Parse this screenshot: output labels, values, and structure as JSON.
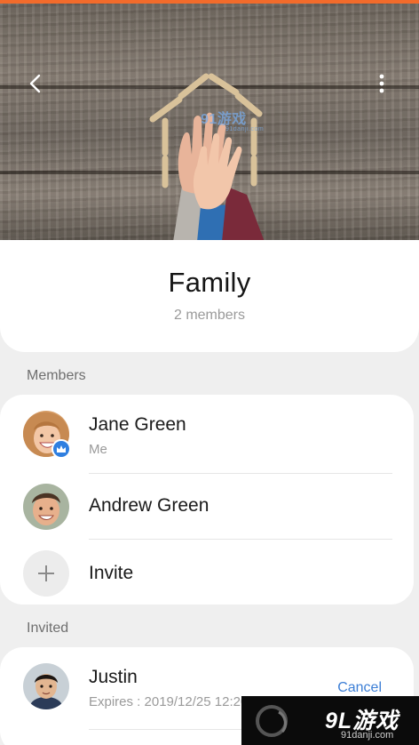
{
  "header": {
    "accent_color": "#f26b2b",
    "back_icon": "chevron-left-icon",
    "more_icon": "more-vertical-icon",
    "watermark_top_logo": "91游戏",
    "watermark_top_url": "91danji.com"
  },
  "group": {
    "name": "Family",
    "member_count": "2 members"
  },
  "members_section": {
    "label": "Members",
    "items": [
      {
        "name": "Jane Green",
        "subtitle": "Me",
        "badge_icon": "crown-icon"
      },
      {
        "name": "Andrew Green"
      },
      {
        "name": "Invite",
        "icon": "plus-icon"
      }
    ]
  },
  "invited_section": {
    "label": "Invited",
    "items": [
      {
        "name": "Justin",
        "expires": "Expires : 2019/12/25 12:20",
        "action": "Cancel"
      }
    ]
  },
  "watermark_bottom": {
    "logo": "9L游戏",
    "url": "91danji.com"
  },
  "colors": {
    "link": "#3d7fd6",
    "badge": "#2f7fe0",
    "secondary_text": "#9a9a9a"
  }
}
